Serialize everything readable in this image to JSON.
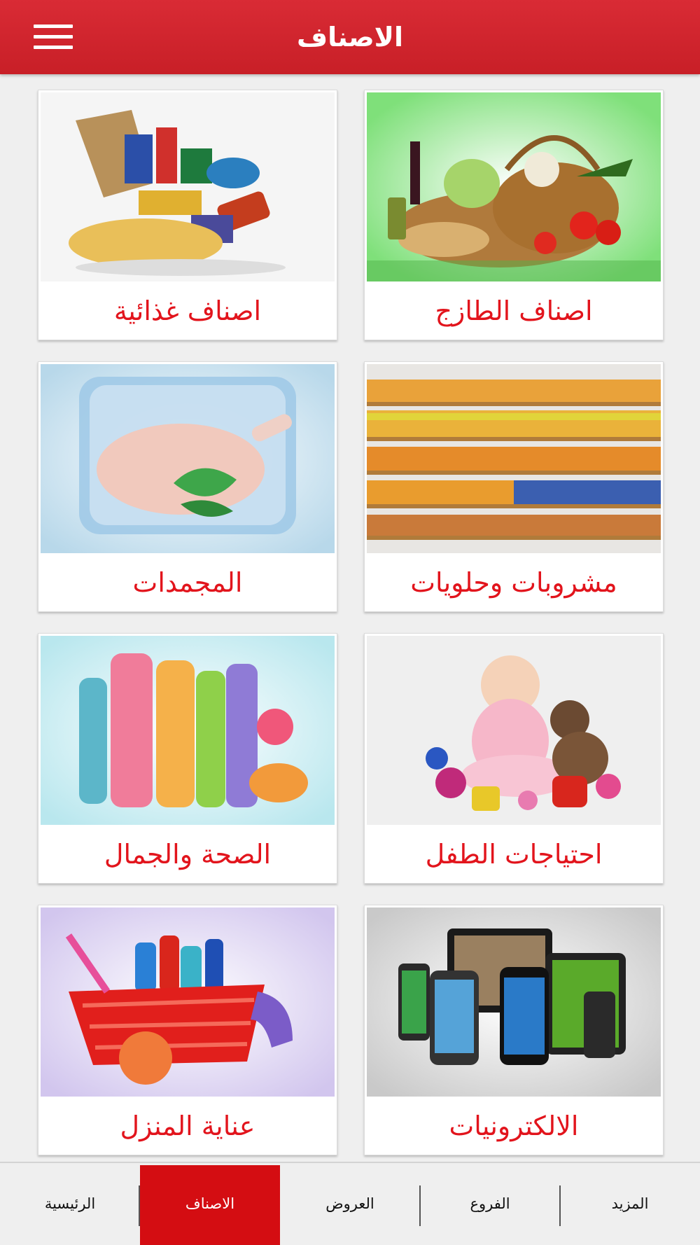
{
  "header": {
    "title": "الاصناف",
    "menu_icon": "hamburger-menu-icon",
    "color": "#d02530"
  },
  "categories": [
    {
      "label": "اصناف الطازج",
      "image": "fresh-produce-basket-image"
    },
    {
      "label": "اصناف غذائية",
      "image": "grocery-bag-food-items-image"
    },
    {
      "label": "مشروبات وحلويات",
      "image": "beverage-shelves-image"
    },
    {
      "label": "المجمدات",
      "image": "frozen-chicken-ice-cube-image"
    },
    {
      "label": "احتياجات الطفل",
      "image": "baby-with-toys-image"
    },
    {
      "label": "الصحة والجمال",
      "image": "cosmetic-bottles-image"
    },
    {
      "label": "الالكترونيات",
      "image": "phones-tablets-image"
    },
    {
      "label": "عناية المنزل",
      "image": "cleaning-supplies-basket-image"
    }
  ],
  "bottom_nav": {
    "items": [
      {
        "label": "المزيد"
      },
      {
        "label": "الفروع"
      },
      {
        "label": "العروض"
      },
      {
        "label": "الاصناف",
        "active": true
      },
      {
        "label": "الرئيسية"
      }
    ],
    "active_color": "#d40d12"
  }
}
